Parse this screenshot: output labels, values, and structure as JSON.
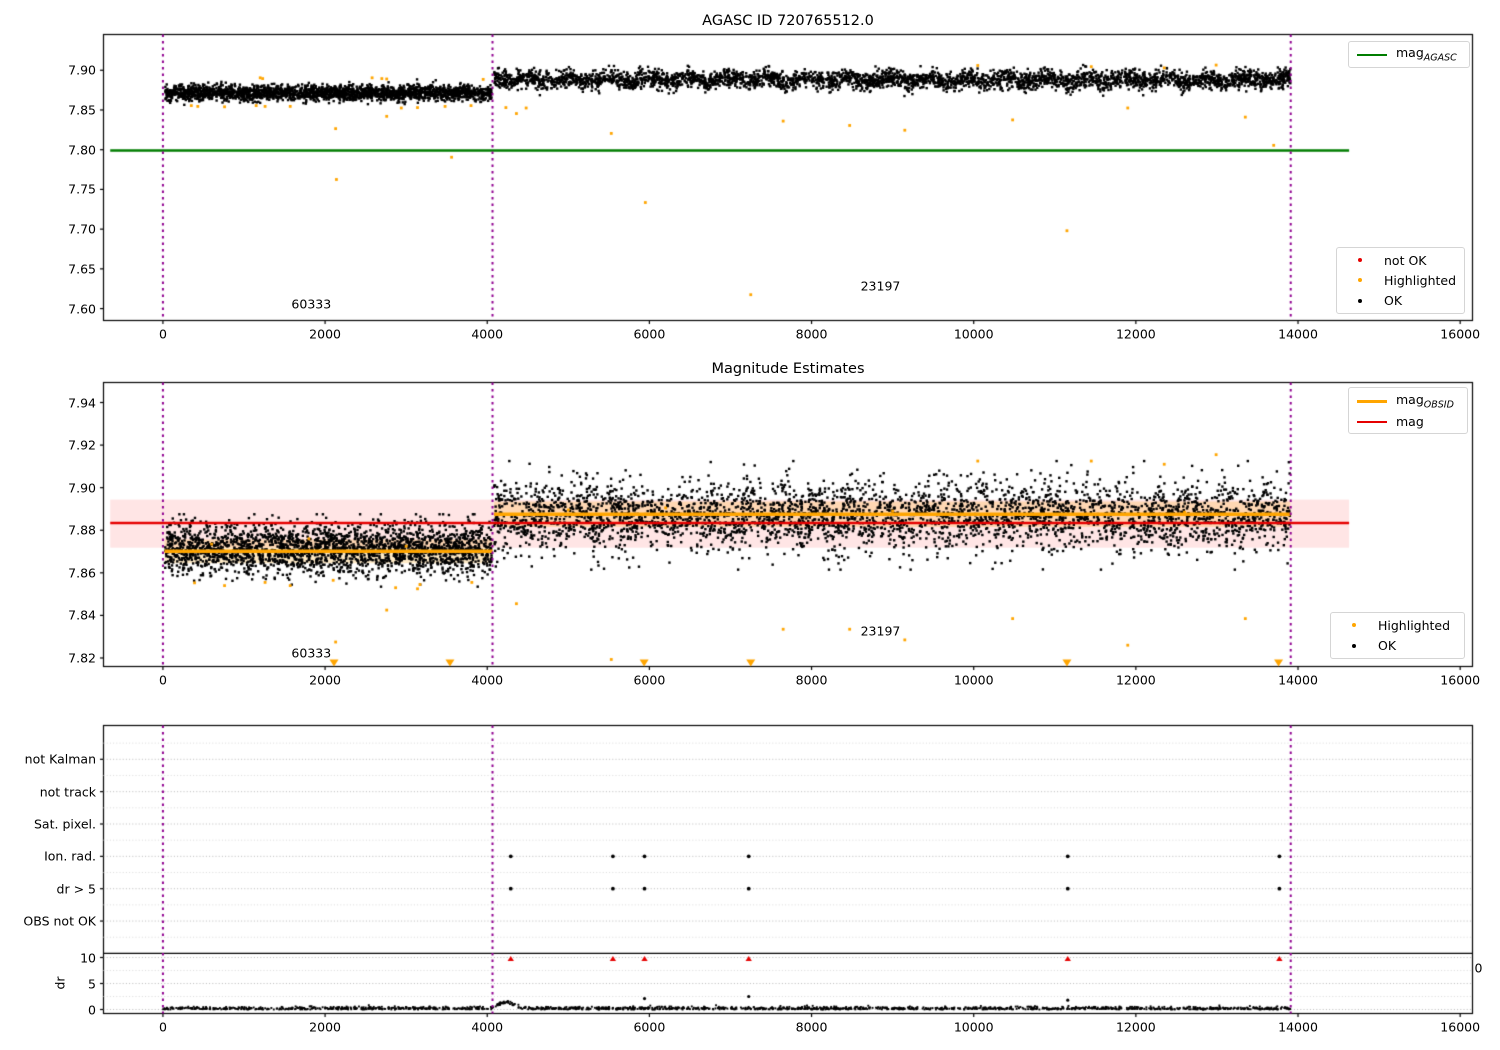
{
  "figure": {
    "bg": "#ffffff"
  },
  "colors": {
    "ok_marker": "#000000",
    "highlighted": "#ffa500",
    "not_ok": "#e60000",
    "agasc_line": "#007d00",
    "mag_line": "#e60000",
    "mag_band": "rgba(255,0,0,0.10)",
    "obsid_line": "#ffa500",
    "obsid_band": "rgba(255,166,0,0.22)",
    "obsid_boundary": "#900090",
    "grid": "#b8b8b8",
    "spine": "#000000"
  },
  "x_axis": {
    "ticks": [
      0,
      2000,
      4000,
      6000,
      8000,
      10000,
      12000,
      14000,
      16000
    ],
    "labels": [
      "0",
      "2000",
      "4000",
      "6000",
      "8000",
      "10000",
      "12000",
      "14000",
      "16000"
    ],
    "xlim": [
      -733,
      16152
    ]
  },
  "obsid_boundaries": [
    0,
    4065,
    13910
  ],
  "chart_data": [
    {
      "type": "scatter",
      "title": "AGASC ID 720765512.0",
      "ylim": [
        7.585,
        7.945
      ],
      "ytick_labels": [
        "7.60",
        "7.65",
        "7.70",
        "7.75",
        "7.80",
        "7.85",
        "7.90"
      ],
      "yticks": [
        7.6,
        7.65,
        7.7,
        7.75,
        7.8,
        7.85,
        7.9
      ],
      "agasc_mag_line": {
        "y": 7.799,
        "x0": -650,
        "x1": 14630
      },
      "clouds": [
        {
          "x_range": [
            25,
            4055
          ],
          "n": 2400,
          "mean": 7.8715,
          "sd": 0.0048,
          "clip": [
            7.8565,
            7.8885
          ],
          "wave_amp": 0.0006,
          "wave_period": 600
        },
        {
          "x_range": [
            4085,
            13905
          ],
          "n": 3600,
          "mean": 7.888,
          "sd": 0.0058,
          "clip": [
            7.8625,
            7.9105
          ],
          "wave_amp": 0.0028,
          "wave_period": 490
        }
      ],
      "highlighted_points": [
        [
          350,
          7.8555
        ],
        [
          430,
          7.8545
        ],
        [
          760,
          7.854
        ],
        [
          1150,
          7.8555
        ],
        [
          1260,
          7.8545
        ],
        [
          1570,
          7.8545
        ],
        [
          2940,
          7.8525
        ],
        [
          3140,
          7.853
        ],
        [
          3480,
          7.8545
        ],
        [
          3800,
          7.8555
        ],
        [
          4230,
          7.853
        ],
        [
          4480,
          7.8525
        ],
        [
          1200,
          7.8905
        ],
        [
          1230,
          7.8895
        ],
        [
          2580,
          7.8905
        ],
        [
          2700,
          7.8895
        ],
        [
          2760,
          7.889
        ],
        [
          3950,
          7.8885
        ],
        [
          2130,
          7.8265
        ],
        [
          2140,
          7.7625
        ],
        [
          2760,
          7.842
        ],
        [
          3560,
          7.7905
        ],
        [
          4360,
          7.8455
        ],
        [
          5530,
          7.8205
        ],
        [
          5950,
          7.7335
        ],
        [
          7250,
          7.6175
        ],
        [
          7650,
          7.836
        ],
        [
          8470,
          7.8305
        ],
        [
          9150,
          7.8245
        ],
        [
          10480,
          7.8375
        ],
        [
          11150,
          7.698
        ],
        [
          11900,
          7.8525
        ],
        [
          13350,
          7.841
        ],
        [
          13700,
          7.8055
        ],
        [
          10050,
          7.906
        ],
        [
          11450,
          7.9045
        ],
        [
          12350,
          7.903
        ],
        [
          12990,
          7.9065
        ]
      ],
      "annotations": [
        {
          "text": "60333",
          "x": 1830,
          "y": 7.606
        },
        {
          "text": "23197",
          "x": 8850,
          "y": 7.628
        }
      ],
      "legends": [
        {
          "pos": "top-right",
          "items": [
            {
              "swatch": "line",
              "color": "#007d00",
              "lw": 2.5,
              "label": {
                "text": "mag",
                "sub": "AGASC"
              }
            }
          ]
        },
        {
          "pos": "bottom-right",
          "items": [
            {
              "swatch": "dot",
              "color": "#e60000",
              "label": {
                "text": "not OK"
              }
            },
            {
              "swatch": "dot",
              "color": "#ffa500",
              "label": {
                "text": "Highlighted"
              }
            },
            {
              "swatch": "dot",
              "color": "#000000",
              "label": {
                "text": "OK"
              }
            }
          ]
        }
      ]
    },
    {
      "type": "scatter",
      "title": "Magnitude Estimates",
      "ylim": [
        7.816,
        7.9494
      ],
      "ytick_labels": [
        "7.82",
        "7.84",
        "7.86",
        "7.88",
        "7.90",
        "7.92",
        "7.94"
      ],
      "yticks": [
        7.82,
        7.84,
        7.86,
        7.88,
        7.9,
        7.92,
        7.94
      ],
      "mag_line": {
        "y": 7.8834,
        "band": [
          7.8718,
          7.8944
        ],
        "x0": -650,
        "x1": 14630
      },
      "obsid_segments": [
        {
          "x0": 20,
          "x1": 4065,
          "y": 7.8701,
          "band": [
            7.8645,
            7.8757
          ]
        },
        {
          "x0": 4085,
          "x1": 13905,
          "y": 7.8875,
          "band": [
            7.8815,
            7.8935
          ]
        }
      ],
      "clouds": [
        {
          "x_range": [
            25,
            4055
          ],
          "n": 2400,
          "mean": 7.871,
          "sd": 0.006,
          "clip": [
            7.8535,
            7.8875
          ],
          "wave_amp": 0.0005,
          "wave_period": 600
        },
        {
          "x_range": [
            4085,
            13905
          ],
          "n": 3600,
          "mean": 7.887,
          "sd": 0.0074,
          "clip": [
            7.8615,
            7.9125
          ],
          "wave_amp": 0.0022,
          "wave_period": 420,
          "mix_sd2": 0.0105,
          "mix_frac": 0.22
        }
      ],
      "highlighted_points": [
        [
          390,
          7.8553
        ],
        [
          760,
          7.854
        ],
        [
          1260,
          7.8555
        ],
        [
          1570,
          7.854
        ],
        [
          2100,
          7.8565
        ],
        [
          2870,
          7.853
        ],
        [
          3140,
          7.8525
        ],
        [
          3170,
          7.8545
        ],
        [
          3810,
          7.8555
        ],
        [
          2130,
          7.8275
        ],
        [
          2760,
          7.8425
        ],
        [
          4360,
          7.8455
        ],
        [
          5530,
          7.8193
        ],
        [
          7650,
          7.8335
        ],
        [
          8470,
          7.8335
        ],
        [
          9150,
          7.8285
        ],
        [
          10480,
          7.8385
        ],
        [
          11900,
          7.826
        ],
        [
          13350,
          7.8385
        ],
        [
          10050,
          7.9125
        ],
        [
          11450,
          7.9125
        ],
        [
          12350,
          7.911
        ],
        [
          12990,
          7.9155
        ],
        [
          600,
          7.8735
        ],
        [
          1800,
          7.876
        ],
        [
          3000,
          7.8725
        ],
        [
          5000,
          7.8895
        ],
        [
          6200,
          7.8905
        ],
        [
          9000,
          7.889
        ],
        [
          12600,
          7.8885
        ]
      ],
      "clipped_low_triangles": [
        2110,
        3540,
        5935,
        7250,
        11150,
        13760
      ],
      "annotations": [
        {
          "text": "60333",
          "x": 1830,
          "y": 7.8225
        },
        {
          "text": "23197",
          "x": 8850,
          "y": 7.8325
        }
      ],
      "legends": [
        {
          "pos": "top-right",
          "items": [
            {
              "swatch": "line",
              "color": "#ffa500",
              "lw": 3.5,
              "label": {
                "text": "mag",
                "sub": "OBSID"
              }
            },
            {
              "swatch": "line",
              "color": "#e60000",
              "lw": 2.5,
              "label": {
                "text": "mag"
              }
            }
          ]
        },
        {
          "pos": "bottom-right",
          "items": [
            {
              "swatch": "dot",
              "color": "#ffa500",
              "label": {
                "text": "Highlighted"
              }
            },
            {
              "swatch": "dot",
              "color": "#000000",
              "label": {
                "text": "OK"
              }
            }
          ]
        }
      ]
    },
    {
      "type": "flags+dr",
      "flag_rows": [
        "not Kalman",
        "not track",
        "Sat. pixel.",
        "Ion. rad.",
        "dr > 5",
        "OBS not OK"
      ],
      "flag_points": {
        "Ion. rad.": [
          4290,
          5550,
          5940,
          7225,
          11160,
          13770
        ],
        "dr > 5": [
          4290,
          5550,
          5940,
          7225,
          11160,
          13770
        ]
      },
      "dr_axis": {
        "label": "dr",
        "ticks": [
          0,
          5,
          10
        ],
        "tick_labels": [
          "0",
          "5",
          "10"
        ]
      },
      "dr_band": {
        "x_range": [
          0,
          13905
        ],
        "n": 1600,
        "mean": 0.18,
        "sd": 0.2,
        "bump": {
          "center": 4230,
          "sigma": 130,
          "amp": 1.15,
          "x0": 4075,
          "x1": 4600
        }
      },
      "dr_clipped_red": [
        4290,
        5550,
        5940,
        7225,
        11160,
        13770
      ],
      "dr_outliers": [
        [
          5940,
          2.1
        ],
        [
          7225,
          2.5
        ],
        [
          11160,
          1.8
        ]
      ],
      "right_edge_label": "0"
    }
  ]
}
